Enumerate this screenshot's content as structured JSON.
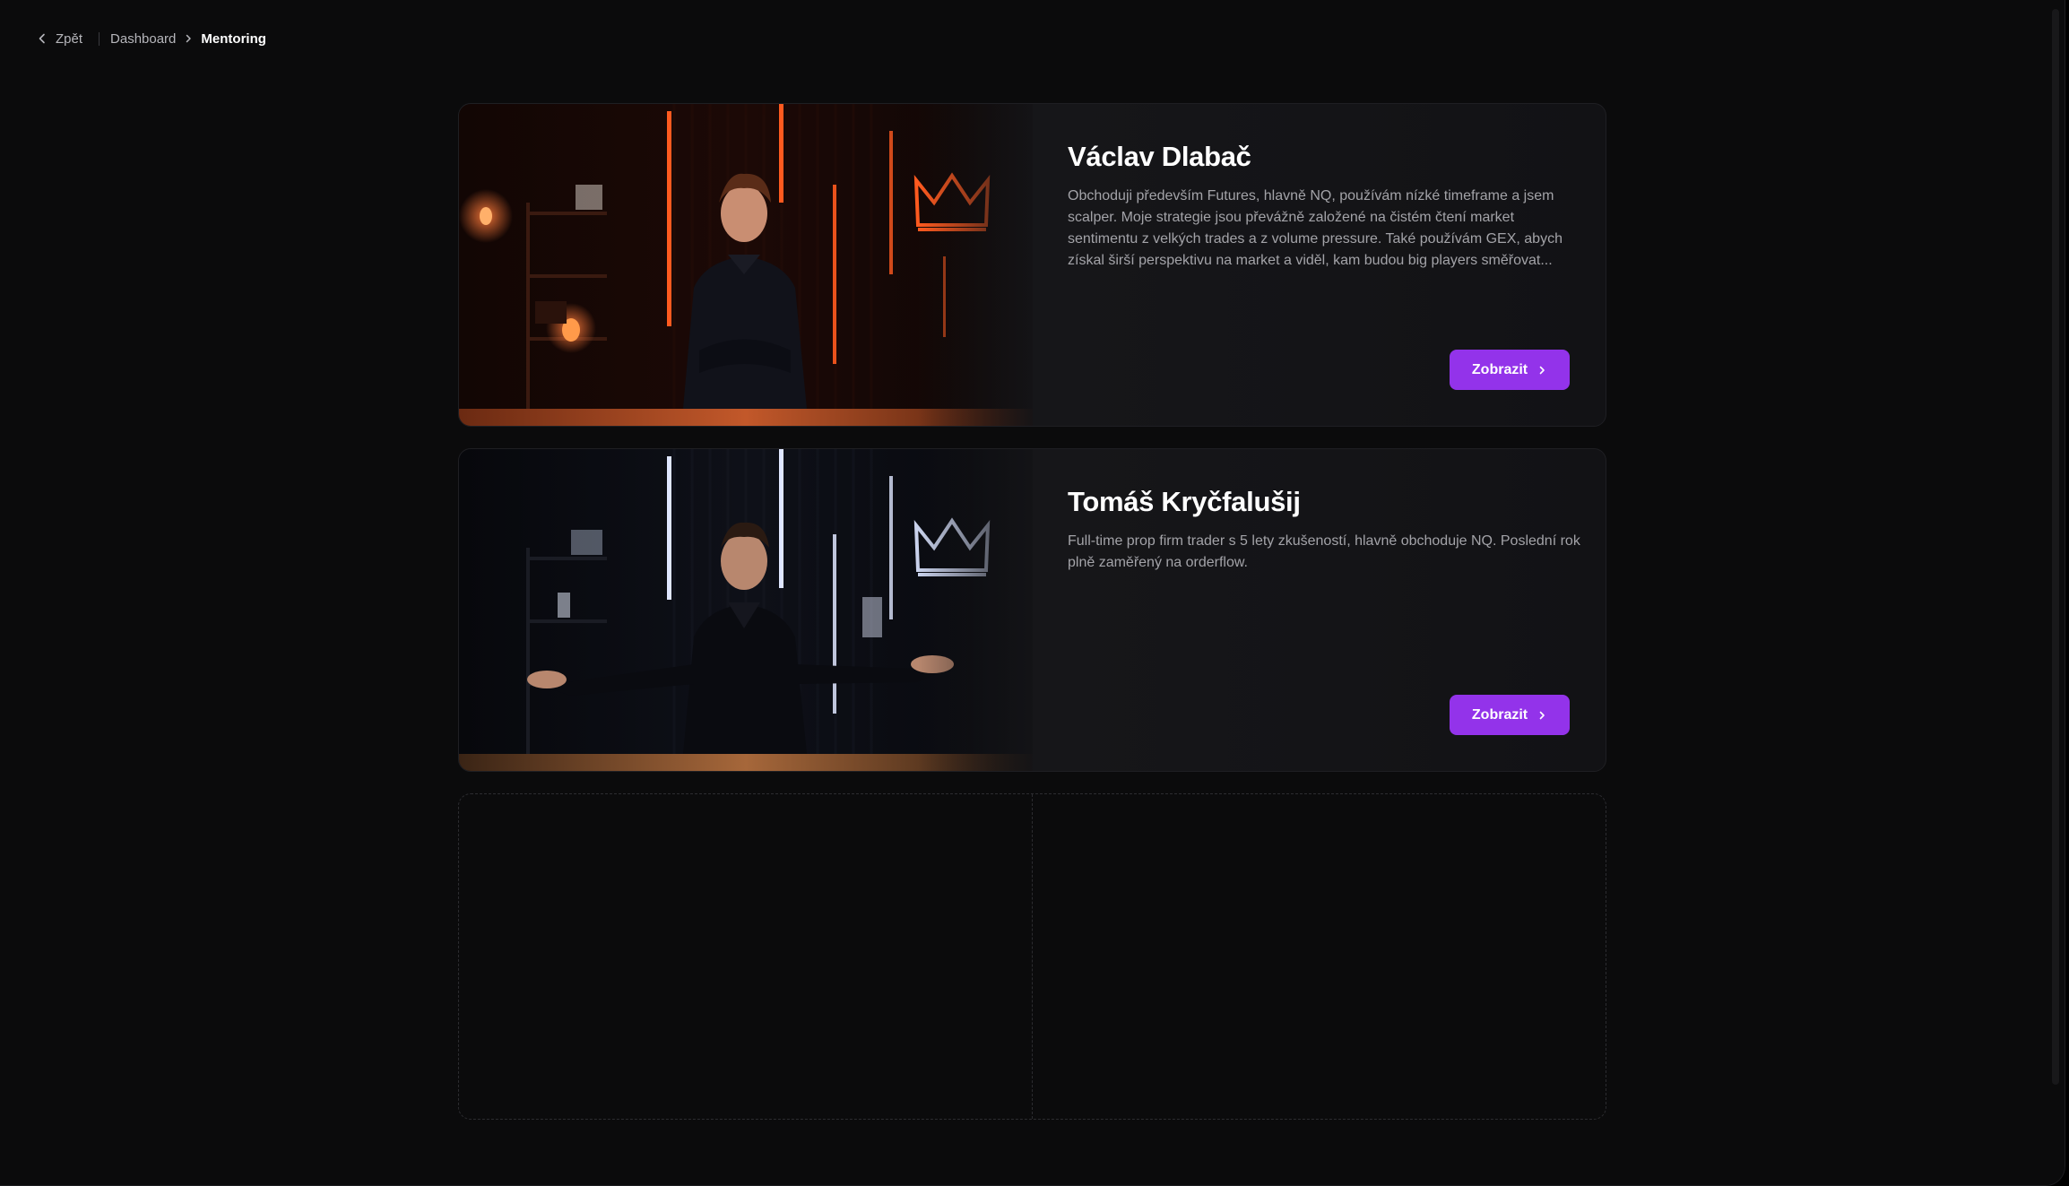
{
  "breadcrumb": {
    "back_label": "Zpět",
    "items": [
      "Dashboard"
    ],
    "current": "Mentoring"
  },
  "mentors": [
    {
      "name": "Václav Dlabač",
      "description": "Obchoduji především Futures, hlavně NQ, používám nízké timeframe a jsem scalper. Moje strategie jsou převážně založené na čistém čtení market sentimentu z velkých trades a z volume pressure. Také používám GEX, abych získal širší perspektivu na market a viděl, kam budou big players směřovat...",
      "button_label": "Zobrazit",
      "accent": "#ff5a1f"
    },
    {
      "name": "Tomáš Kryčfalušij",
      "description": "Full-time prop firm trader s 5 lety zkušeností, hlavně obchoduje NQ. Poslední rok plně zaměřený na orderflow.",
      "button_label": "Zobrazit",
      "accent": "#dfe6ff"
    }
  ],
  "colors": {
    "background": "#0b0b0c",
    "card": "#141417",
    "button": "#9333ea",
    "muted_text": "#a3a3a8"
  },
  "icons": {
    "back": "chevron-left-icon",
    "separator": "chevron-right-icon",
    "button": "chevron-right-icon"
  }
}
